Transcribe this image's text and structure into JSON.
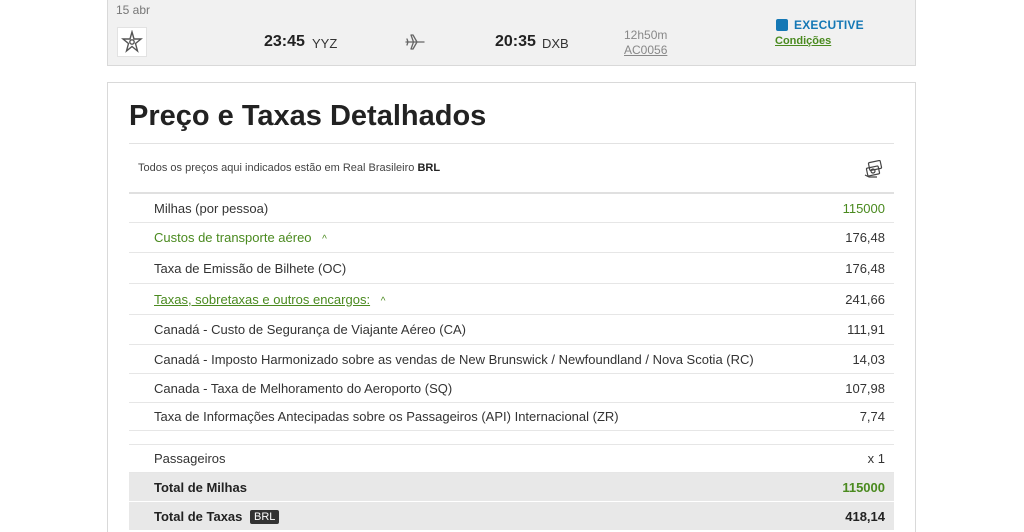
{
  "flight": {
    "date": "15 abr",
    "departure_time": "23:45",
    "departure_code": "YYZ",
    "arrival_time": "20:35",
    "arrival_code": "DXB",
    "duration": "12h50m",
    "flight_number": "AC0056",
    "cabin": "EXECUTIVE",
    "conditions_label": "Condições",
    "colors": {
      "cabin": "#1578b5",
      "link": "#4a8a1f"
    },
    "icons": {
      "airline": "airline-logo-icon",
      "plane": "plane-icon"
    }
  },
  "price": {
    "title": "Preço e Taxas Detalhados",
    "currency_note_text": "Todos os preços aqui indicados estão em Real Brasileiro",
    "currency_code": "BRL",
    "currency_icon": "currency-exchange-icon",
    "rows": [
      {
        "label": "Milhas (por pessoa)",
        "value": "115000"
      },
      {
        "label": "Custos de transporte aéreo",
        "value": "176,48"
      },
      {
        "label": "Taxa de Emissão de Bilhete (OC)",
        "value": "176,48"
      },
      {
        "label": "Taxas, sobretaxas e outros encargos:",
        "value": "241,66"
      },
      {
        "label": "Canadá - Custo de Segurança de Viajante Aéreo (CA)",
        "value": "111,91"
      },
      {
        "label": "Canadá - Imposto Harmonizado sobre as vendas de New Brunswick / Newfoundland / Nova Scotia (RC)",
        "value": "14,03"
      },
      {
        "label": "Canada - Taxa de Melhoramento do Aeroporto (SQ)",
        "value": "107,98"
      },
      {
        "label": "Taxa de Informações Antecipadas sobre os Passageiros (API) Internacional (ZR)",
        "value": "7,74"
      }
    ],
    "passengers_label": "Passageiros",
    "passengers_value": "x 1",
    "total_miles_label": "Total de Milhas",
    "total_miles_value": "115000",
    "total_taxes_label": "Total de Taxas",
    "total_taxes_currency": "BRL",
    "total_taxes_value": "418,14",
    "colors": {
      "accent_green": "#4a8a1f",
      "total_bg": "#e8e8e8"
    }
  }
}
